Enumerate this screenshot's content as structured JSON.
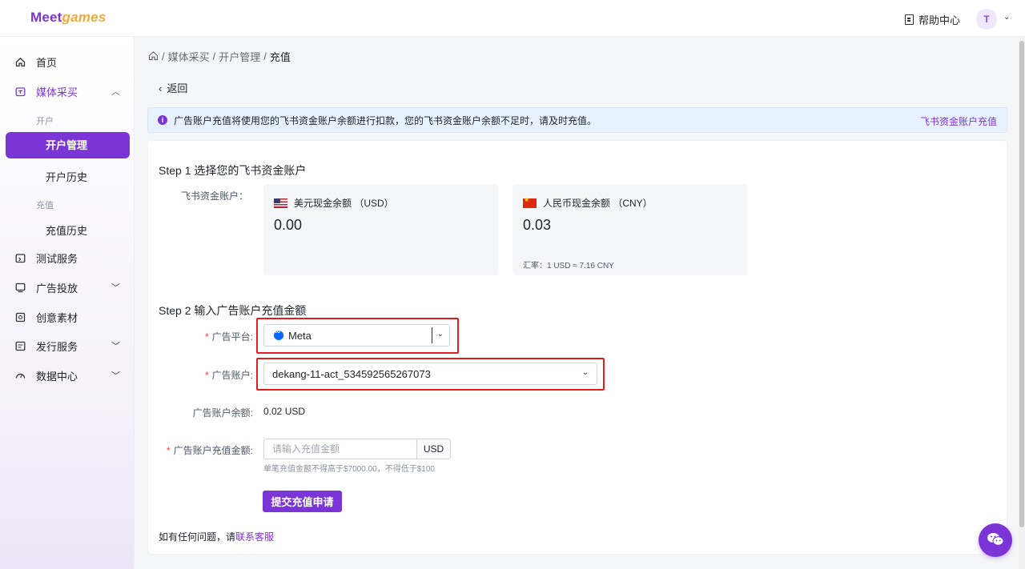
{
  "app": {
    "logo_main": "Meet",
    "logo_accent": "games",
    "help_label": "帮助中心",
    "avatar_initial": "T"
  },
  "sidebar": {
    "home": "首页",
    "media": "媒体采买",
    "group_open": "开户",
    "account_mgmt": "开户管理",
    "account_history": "开户历史",
    "group_recharge": "充值",
    "recharge_history": "充值历史",
    "test_service": "测试服务",
    "ad_delivery": "广告投放",
    "creative": "创意素材",
    "publish": "发行服务",
    "data_center": "数据中心"
  },
  "breadcrumb": {
    "home_icon": "home-icon",
    "items": [
      "媒体采买",
      "开户管理",
      "充值"
    ]
  },
  "back_label": "返回",
  "notice": {
    "text": "广告账户充值将使用您的飞书资金账户余额进行扣款，您的飞书资金账户余额不足时，请及时充值。",
    "link": "飞书资金账户充值"
  },
  "step1": {
    "title": "Step 1 选择您的飞书资金账户",
    "label": "飞书资金账户：",
    "usd": {
      "title": "美元现金余额 （USD）",
      "amount": "0.00"
    },
    "cny": {
      "title": "人民币现金余额 （CNY）",
      "amount": "0.03",
      "rate": "汇率：1 USD ≈ 7.16 CNY"
    }
  },
  "step2": {
    "title": "Step 2 输入广告账户充值金额",
    "platform_label": "广告平台:",
    "platform_value": "Meta",
    "account_label": "广告账户:",
    "account_value": "dekang-11-act_534592565267073",
    "balance_label": "广告账户余额:",
    "balance_value": "0.02 USD",
    "amount_label": "广告账户充值金额:",
    "amount_placeholder": "请输入充值金额",
    "amount_unit": "USD",
    "amount_hint": "单笔充值金额不得高于$7000.00，不得低于$100",
    "submit": "提交充值申请"
  },
  "contact": {
    "prefix": "如有任何问题，请",
    "link": "联系客服"
  },
  "colors": {
    "accent": "#7b35d6",
    "notice_bg": "#e8f2ff",
    "highlight": "#e11d1d"
  }
}
